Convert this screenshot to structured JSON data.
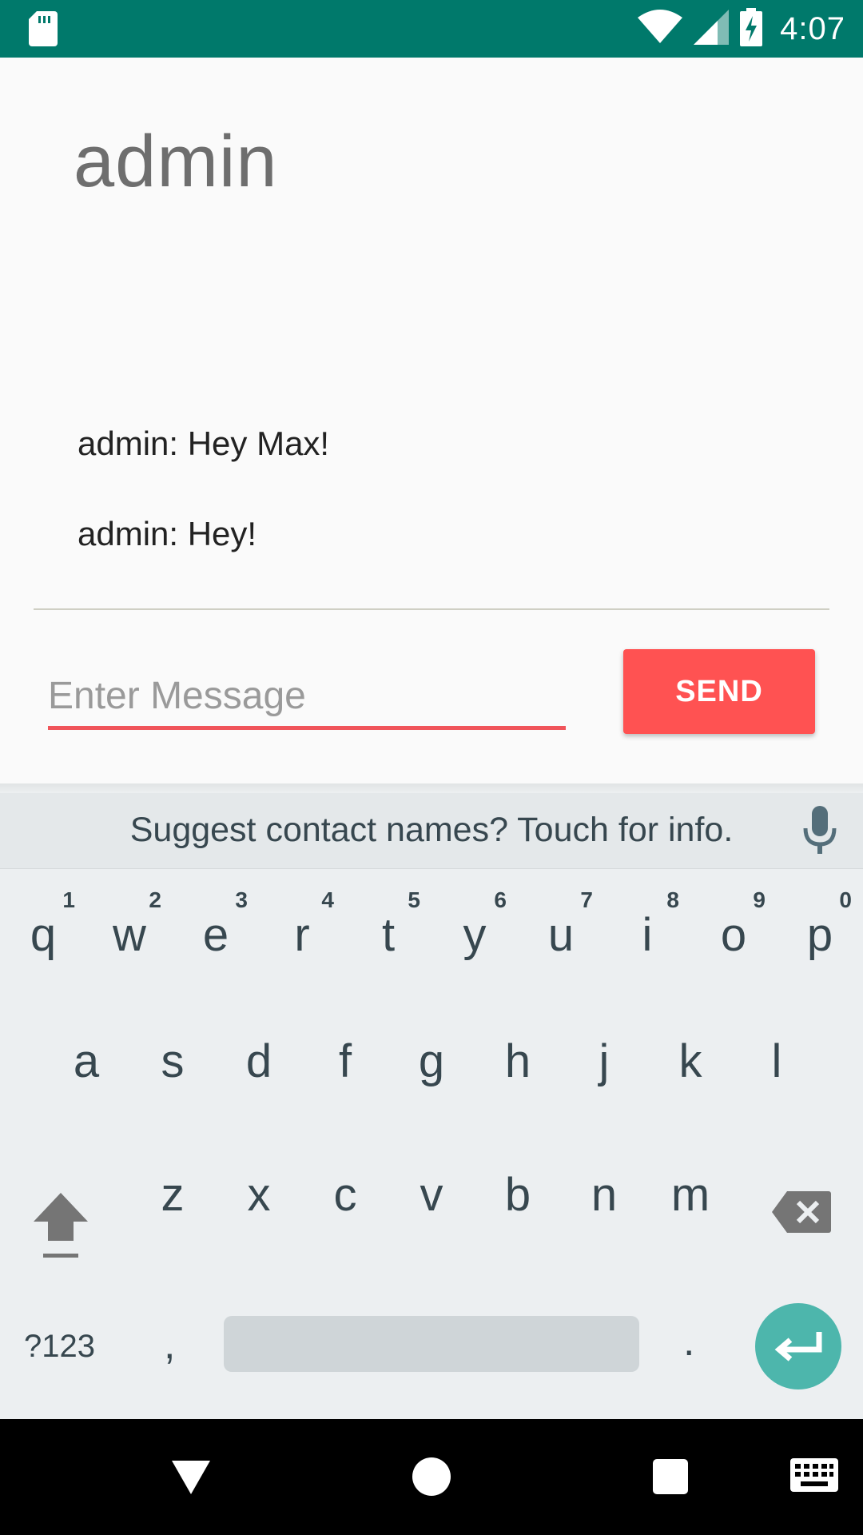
{
  "status_bar": {
    "time": "4:07",
    "icons": [
      "sd-card-icon",
      "wifi-icon",
      "signal-icon",
      "battery-charging-icon"
    ],
    "background": "#00796b"
  },
  "chat": {
    "title": "admin",
    "messages": [
      {
        "text": "admin: Hey Max!"
      },
      {
        "text": "admin: Hey!"
      }
    ],
    "input": {
      "value": "",
      "placeholder": "Enter Message"
    },
    "send_label": "SEND",
    "accent": "#ff5252"
  },
  "keyboard": {
    "suggestion": "Suggest contact names? Touch for info.",
    "row1": [
      {
        "ch": "q",
        "num": "1"
      },
      {
        "ch": "w",
        "num": "2"
      },
      {
        "ch": "e",
        "num": "3"
      },
      {
        "ch": "r",
        "num": "4"
      },
      {
        "ch": "t",
        "num": "5"
      },
      {
        "ch": "y",
        "num": "6"
      },
      {
        "ch": "u",
        "num": "7"
      },
      {
        "ch": "i",
        "num": "8"
      },
      {
        "ch": "o",
        "num": "9"
      },
      {
        "ch": "p",
        "num": "0"
      }
    ],
    "row2": [
      "a",
      "s",
      "d",
      "f",
      "g",
      "h",
      "j",
      "k",
      "l"
    ],
    "row3": [
      "z",
      "x",
      "c",
      "v",
      "b",
      "n",
      "m"
    ],
    "symbols_label": "?123",
    "comma_label": ",",
    "period_label": ".",
    "enter_color": "#4db6ac"
  },
  "nav_bar": {
    "icons": [
      "back-icon",
      "home-icon",
      "recents-icon",
      "keyboard-switch-icon"
    ]
  }
}
